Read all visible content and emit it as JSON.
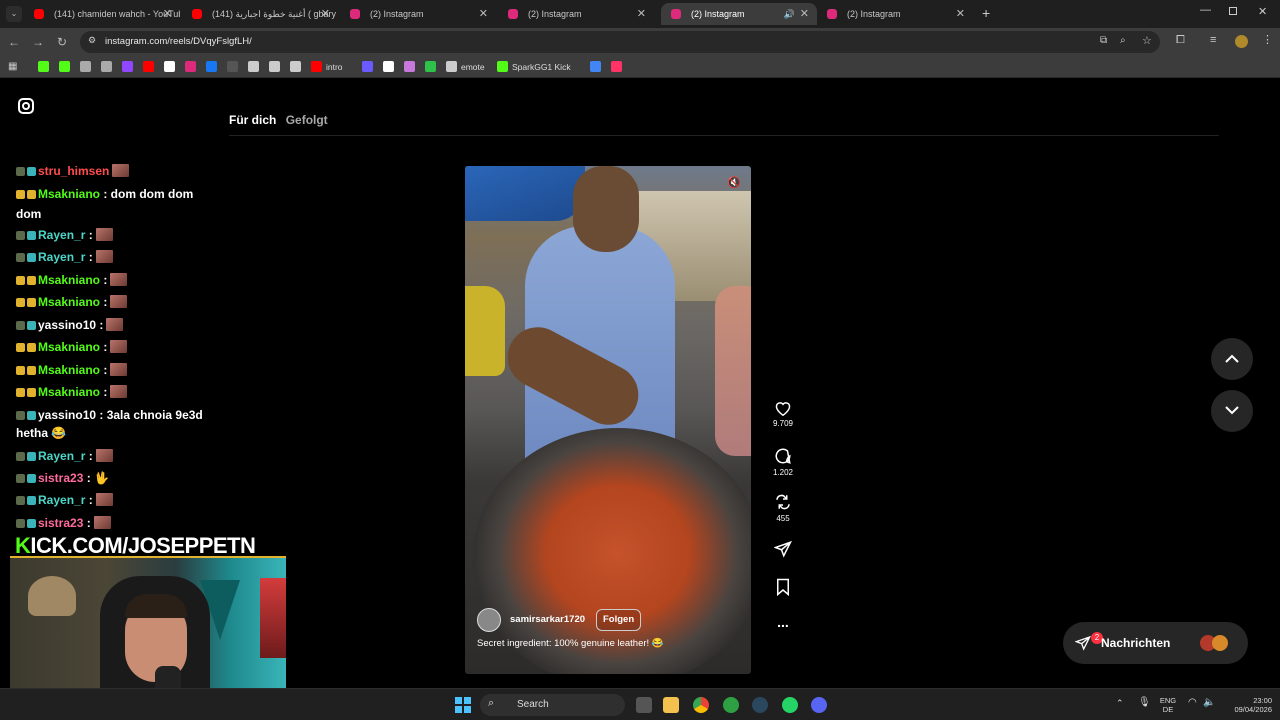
{
  "browser": {
    "tabs": [
      {
        "title": "(141) chamiden wahch - YouTube",
        "favicon_color": "#ff0000",
        "active": false
      },
      {
        "title": "(141) أغنية خطوة اجبارية ( gbary",
        "favicon_color": "#ff0000",
        "active": false
      },
      {
        "title": "(2) Instagram",
        "favicon_color": "#dd2a7b",
        "active": false
      },
      {
        "title": "(2) Instagram",
        "favicon_color": "#dd2a7b",
        "active": false
      },
      {
        "title": "(2) Instagram",
        "favicon_color": "#dd2a7b",
        "active": true
      },
      {
        "title": "(2) Instagram",
        "favicon_color": "#dd2a7b",
        "active": false
      }
    ],
    "close_glyph": "✕",
    "new_tab_glyph": "+",
    "url": "instagram.com/reels/DVqyFslgfLH/",
    "bookmarks": [
      {
        "label": "",
        "color": "#53fc18"
      },
      {
        "label": "",
        "color": "#53fc18"
      },
      {
        "label": "",
        "color": "#aaaaaa"
      },
      {
        "label": "",
        "color": "#aaaaaa"
      },
      {
        "label": "",
        "color": "#9146ff"
      },
      {
        "label": "",
        "color": "#ff0000"
      },
      {
        "label": "",
        "color": "#ffffff"
      },
      {
        "label": "",
        "color": "#dd2a7b"
      },
      {
        "label": "",
        "color": "#1877f2"
      },
      {
        "label": "",
        "color": "#555555"
      },
      {
        "label": "",
        "color": "#cccccc"
      },
      {
        "label": "",
        "color": "#cccccc"
      },
      {
        "label": "",
        "color": "#cccccc"
      },
      {
        "label": "intro",
        "color": "#ff0000"
      },
      {
        "label": "",
        "color": "#6b5bff"
      },
      {
        "label": "",
        "color": "#ffffff"
      },
      {
        "label": "",
        "color": "#c678dd"
      },
      {
        "label": "",
        "color": "#2ec24a"
      },
      {
        "label": "emote",
        "color": "#cccccc"
      },
      {
        "label": "SparkGG1 Kick",
        "color": "#53fc18"
      },
      {
        "label": "",
        "color": "#4285f4"
      },
      {
        "label": "",
        "color": "#ff3366"
      }
    ]
  },
  "instagram": {
    "feed_tabs": [
      "Für dich",
      "Gefolgt"
    ],
    "reel": {
      "username": "samirsarkar1720",
      "follow_label": "Folgen",
      "caption": "Secret ingredient: 100% genuine leather! 😂"
    },
    "actions": [
      {
        "name": "like",
        "count": "9.709"
      },
      {
        "name": "comment",
        "count": "1.202"
      },
      {
        "name": "repost",
        "count": "455"
      },
      {
        "name": "share",
        "count": ""
      },
      {
        "name": "save",
        "count": ""
      },
      {
        "name": "more",
        "count": "..."
      }
    ],
    "messages": {
      "label": "Nachrichten",
      "badge": "2"
    }
  },
  "stream_overlay": {
    "chat": [
      {
        "user": "stru_himsen",
        "user_color": "#ff4d4d",
        "text": ""
      },
      {
        "user": "Msakniano",
        "user_color": "#53fc18",
        "text": " : dom dom dom"
      },
      {
        "user": "",
        "user_color": "#ffffff",
        "text": "dom"
      },
      {
        "user": "Rayen_r",
        "user_color": "#4dd6c7",
        "text": " :"
      },
      {
        "user": "Rayen_r",
        "user_color": "#4dd6c7",
        "text": " :"
      },
      {
        "user": "Msakniano",
        "user_color": "#53fc18",
        "text": " :"
      },
      {
        "user": "Msakniano",
        "user_color": "#53fc18",
        "text": " :"
      },
      {
        "user": "yassino10",
        "user_color": "#ffffff",
        "text": " :"
      },
      {
        "user": "Msakniano",
        "user_color": "#53fc18",
        "text": " :"
      },
      {
        "user": "Msakniano",
        "user_color": "#53fc18",
        "text": " :"
      },
      {
        "user": "Msakniano",
        "user_color": "#53fc18",
        "text": " :"
      },
      {
        "user": "yassino10",
        "user_color": "#ffffff",
        "text": " : 3ala chnoia 9e3d"
      },
      {
        "user": "",
        "user_color": "#ffffff",
        "text": "hetha 😂"
      },
      {
        "user": "Rayen_r",
        "user_color": "#4dd6c7",
        "text": " :"
      },
      {
        "user": "sistra23",
        "user_color": "#ff6b9d",
        "text": " : 🖖"
      },
      {
        "user": "Rayen_r",
        "user_color": "#4dd6c7",
        "text": " :"
      },
      {
        "user": "sistra23",
        "user_color": "#ff6b9d",
        "text": " :"
      }
    ],
    "kick_prefix": "K",
    "kick_rest": "ICK.COM/JOSEPPETN"
  },
  "taskbar": {
    "search_label": "Search",
    "lang_top": "ENG",
    "lang_bottom": "DE",
    "time": "23:00",
    "date": "09/04/2026"
  }
}
